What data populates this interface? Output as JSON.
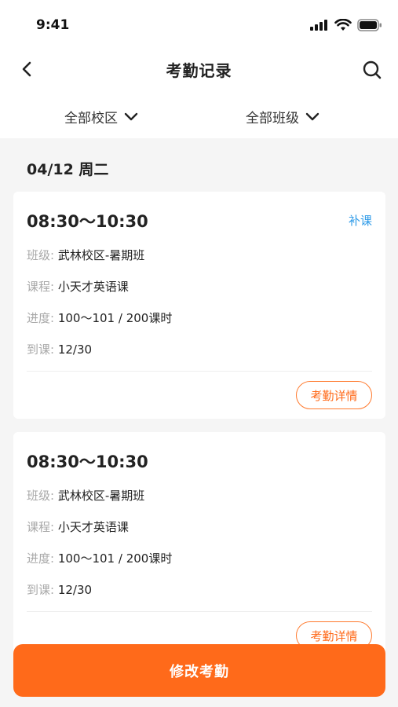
{
  "status_bar": {
    "time": "9:41"
  },
  "nav": {
    "title": "考勤记录",
    "back_icon": "chevron-left-icon",
    "search_icon": "search-icon"
  },
  "filters": {
    "campus": "全部校区",
    "class": "全部班级"
  },
  "date_header": "04/12 周二",
  "records": [
    {
      "time": "08:30～10:30",
      "tag": "补课",
      "class_label": "班级:",
      "class_value": "武林校区-暑期班",
      "course_label": "课程:",
      "course_value": "小天才英语课",
      "progress_label": "进度:",
      "progress_value": "100～101 / 200课时",
      "attendance_label": "到课:",
      "attendance_value": "12/30",
      "detail_button": "考勤详情"
    },
    {
      "time": "08:30～10:30",
      "tag": "",
      "class_label": "班级:",
      "class_value": "武林校区-暑期班",
      "course_label": "课程:",
      "course_value": "小天才英语课",
      "progress_label": "进度:",
      "progress_value": "100～101 / 200课时",
      "attendance_label": "到课:",
      "attendance_value": "12/30",
      "detail_button": "考勤详情"
    }
  ],
  "bottom_button": "修改考勤",
  "colors": {
    "accent": "#ff6a1a",
    "tag_blue": "#2f9be8",
    "label_gray": "#a8a8a8"
  }
}
